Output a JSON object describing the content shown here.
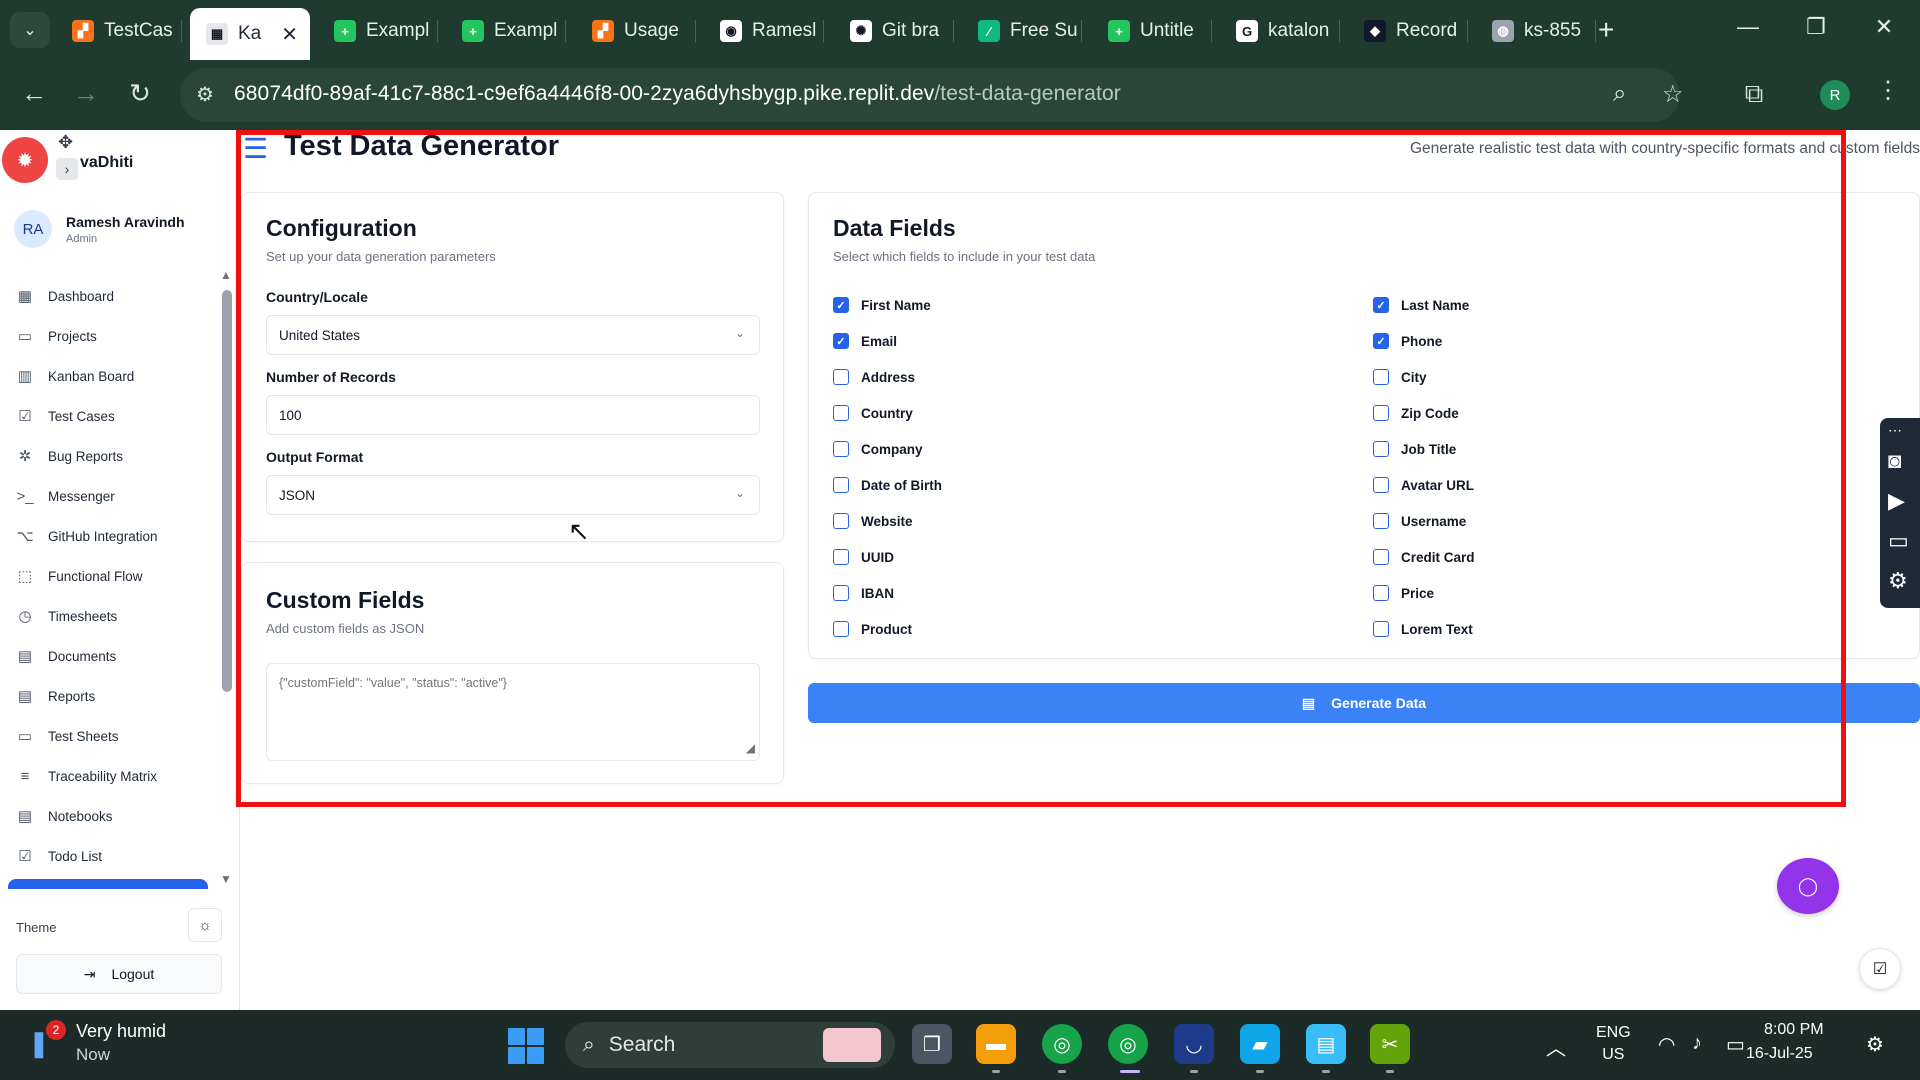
{
  "browser": {
    "tabs": [
      {
        "label": "TestCas",
        "fav_color": "#f97316",
        "fav_glyph": "▞"
      },
      {
        "label": "Ka",
        "fav_color": "#e5e7eb",
        "fav_glyph": "▦",
        "active": true,
        "close": "✕"
      },
      {
        "label": "Exampl",
        "fav_color": "#22c55e",
        "fav_glyph": "+"
      },
      {
        "label": "Exampl",
        "fav_color": "#22c55e",
        "fav_glyph": "+"
      },
      {
        "label": "Usage",
        "fav_color": "#f97316",
        "fav_glyph": "▞"
      },
      {
        "label": "Ramesl",
        "fav_color": "#ffffff",
        "fav_glyph": "◉"
      },
      {
        "label": "Git bra",
        "fav_color": "#ffffff",
        "fav_glyph": "✺"
      },
      {
        "label": "Free Su",
        "fav_color": "#10b981",
        "fav_glyph": "⁄"
      },
      {
        "label": "Untitle",
        "fav_color": "#22c55e",
        "fav_glyph": "+"
      },
      {
        "label": "katalon",
        "fav_color": "#ffffff",
        "fav_glyph": "G"
      },
      {
        "label": "Record",
        "fav_color": "#111827",
        "fav_glyph": "◆"
      },
      {
        "label": "ks-855",
        "fav_color": "#9ca3af",
        "fav_glyph": "◍"
      }
    ],
    "new_tab": "+",
    "url_host": "68074df0-89af-41c7-88c1-c9ef6a4446f8-00-2zya6dyhsbygp.pike.replit.dev",
    "url_path": "/test-data-generator",
    "profile_initial": "R"
  },
  "sidebar": {
    "brand": "vaDhiti",
    "user": {
      "initials": "RA",
      "name": "Ramesh Aravindh",
      "role": "Admin"
    },
    "items": [
      {
        "label": "Dashboard",
        "icon": "▦"
      },
      {
        "label": "Projects",
        "icon": "▭"
      },
      {
        "label": "Kanban Board",
        "icon": "▥"
      },
      {
        "label": "Test Cases",
        "icon": "☑"
      },
      {
        "label": "Bug Reports",
        "icon": "✲"
      },
      {
        "label": "Messenger",
        "icon": ">_"
      },
      {
        "label": "GitHub Integration",
        "icon": "⌥"
      },
      {
        "label": "Functional Flow",
        "icon": "⬚"
      },
      {
        "label": "Timesheets",
        "icon": "◷"
      },
      {
        "label": "Documents",
        "icon": "▤"
      },
      {
        "label": "Reports",
        "icon": "▤"
      },
      {
        "label": "Test Sheets",
        "icon": "▭"
      },
      {
        "label": "Traceability Matrix",
        "icon": "≡"
      },
      {
        "label": "Notebooks",
        "icon": "▤"
      },
      {
        "label": "Todo List",
        "icon": "☑"
      }
    ],
    "theme_label": "Theme",
    "logout_label": "Logout"
  },
  "page": {
    "title": "Test Data Generator",
    "subtitle": "Generate realistic test data with country-specific formats and custom fields"
  },
  "config": {
    "title": "Configuration",
    "description": "Set up your data generation parameters",
    "country_label": "Country/Locale",
    "country_value": "United States",
    "records_label": "Number of Records",
    "records_value": "100",
    "format_label": "Output Format",
    "format_value": "JSON"
  },
  "custom_fields": {
    "title": "Custom Fields",
    "description": "Add custom fields as JSON",
    "placeholder": "{\"customField\": \"value\", \"status\": \"active\"}"
  },
  "data_fields": {
    "title": "Data Fields",
    "description": "Select which fields to include in your test data",
    "fields": [
      {
        "label": "First Name",
        "checked": true
      },
      {
        "label": "Last Name",
        "checked": true
      },
      {
        "label": "Email",
        "checked": true
      },
      {
        "label": "Phone",
        "checked": true
      },
      {
        "label": "Address",
        "checked": false
      },
      {
        "label": "City",
        "checked": false
      },
      {
        "label": "Country",
        "checked": false
      },
      {
        "label": "Zip Code",
        "checked": false
      },
      {
        "label": "Company",
        "checked": false
      },
      {
        "label": "Job Title",
        "checked": false
      },
      {
        "label": "Date of Birth",
        "checked": false
      },
      {
        "label": "Avatar URL",
        "checked": false
      },
      {
        "label": "Website",
        "checked": false
      },
      {
        "label": "Username",
        "checked": false
      },
      {
        "label": "UUID",
        "checked": false
      },
      {
        "label": "Credit Card",
        "checked": false
      },
      {
        "label": "IBAN",
        "checked": false
      },
      {
        "label": "Price",
        "checked": false
      },
      {
        "label": "Product",
        "checked": false
      },
      {
        "label": "Lorem Text",
        "checked": false
      }
    ]
  },
  "generate_label": "Generate Data",
  "taskbar": {
    "weather_title": "Very humid",
    "weather_sub": "Now",
    "weather_badge": "2",
    "search_label": "Search",
    "lang_line1": "ENG",
    "lang_line2": "US",
    "time": "8:00 PM",
    "date": "16-Jul-25"
  },
  "colors": {
    "accent": "#3b82f6",
    "highlight_frame": "#ef1010",
    "chat_fab": "#9333ea"
  }
}
